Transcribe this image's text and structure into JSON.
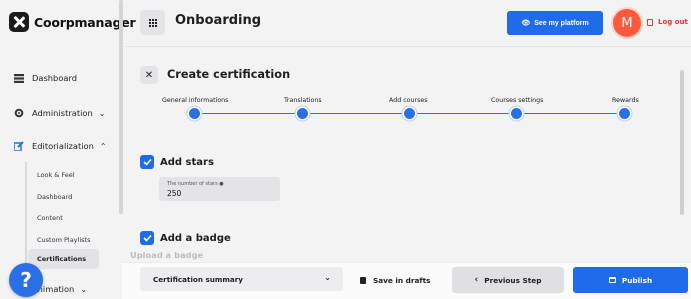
{
  "app": {
    "brand": "Coorpmanager"
  },
  "header": {
    "title": "Onboarding",
    "see_platform_label": "See my platform",
    "avatar_initial": "M",
    "logout_label": "Log out"
  },
  "sidebar": {
    "items": [
      {
        "label": "Dashboard"
      },
      {
        "label": "Administration"
      },
      {
        "label": "Editorialization"
      },
      {
        "label": "Animation"
      }
    ],
    "subitems": [
      {
        "label": "Look & Feel"
      },
      {
        "label": "Dashboard"
      },
      {
        "label": "Content"
      },
      {
        "label": "Custom Playlists"
      },
      {
        "label": "Certifications"
      }
    ],
    "help_label": "?"
  },
  "form": {
    "title": "Create certification",
    "steps": [
      {
        "label": "General informations"
      },
      {
        "label": "Translations"
      },
      {
        "label": "Add courses"
      },
      {
        "label": "Courses settings"
      },
      {
        "label": "Rewards"
      }
    ],
    "stars": {
      "checkbox_label": "Add stars",
      "field_label": "The number of stars",
      "value": "250"
    },
    "badge": {
      "checkbox_label": "Add a badge",
      "upload_label": "Upload a badge"
    }
  },
  "footer": {
    "summary_label": "Certification summary",
    "save_label": "Save in drafts",
    "prev_label": "Previous Step",
    "publish_label": "Publish"
  },
  "colors": {
    "accent": "#1f6be9",
    "avatar": "#ff5a3c",
    "logout": "#e2333a"
  }
}
